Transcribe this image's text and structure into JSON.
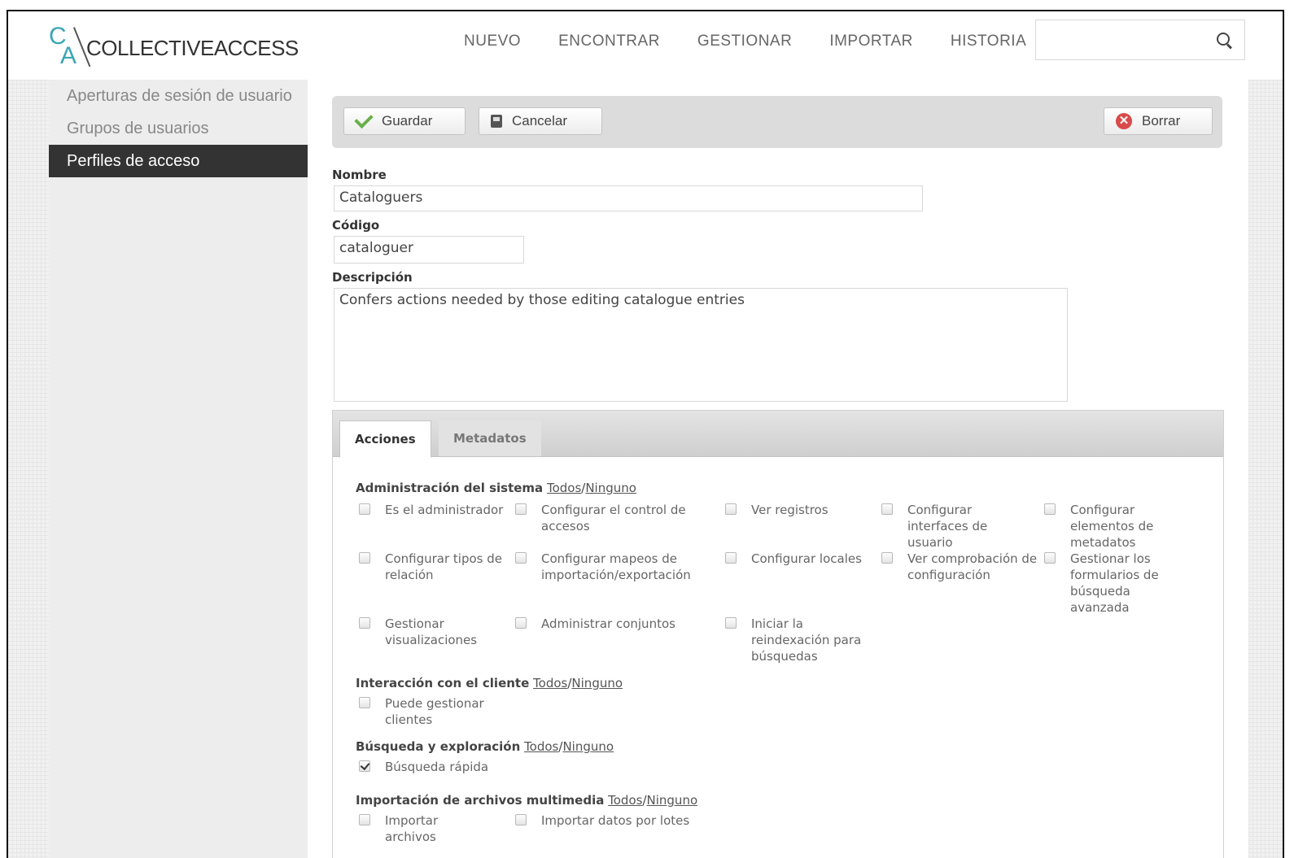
{
  "header": {
    "logo_c": "C",
    "logo_a": "A",
    "logo_word": "COLLECTIVEACCESS",
    "nav": [
      "NUEVO",
      "ENCONTRAR",
      "GESTIONAR",
      "IMPORTAR",
      "HISTORIA"
    ],
    "search_value": ""
  },
  "sidebar": {
    "items": [
      {
        "label": "Aperturas de sesión de usuario"
      },
      {
        "label": "Grupos de usuarios"
      },
      {
        "label": "Perfiles de acceso"
      }
    ]
  },
  "toolbar": {
    "save_label": "Guardar",
    "cancel_label": "Cancelar",
    "delete_label": "Borrar"
  },
  "form": {
    "name_label": "Nombre",
    "name_value": "Cataloguers",
    "code_label": "Código",
    "code_value": "cataloguer",
    "desc_label": "Descripción",
    "desc_value": "Confers actions needed by those editing catalogue entries"
  },
  "tabs": [
    "Acciones",
    "Metadatos"
  ],
  "links": {
    "all": "Todos",
    "none": "Ninguno"
  },
  "sections": [
    {
      "title": "Administración del sistema",
      "perms": [
        {
          "label": "Es el administrador",
          "checked": false
        },
        {
          "label": "Configurar el control de accesos",
          "checked": false
        },
        {
          "label": "Ver registros",
          "checked": false
        },
        {
          "label": "Configurar interfaces de usuario",
          "checked": false
        },
        {
          "label": "Configurar elementos de metadatos",
          "checked": false
        },
        {
          "label": "Configurar tipos de relación",
          "checked": false
        },
        {
          "label": "Configurar mapeos de importación/exportación",
          "checked": false
        },
        {
          "label": "Configurar locales",
          "checked": false
        },
        {
          "label": "Ver comprobación de configuración",
          "checked": false
        },
        {
          "label": "Gestionar los formularios de búsqueda avanzada",
          "checked": false
        },
        {
          "label": "Gestionar visualizaciones",
          "checked": false
        },
        {
          "label": "Administrar conjuntos",
          "checked": false
        },
        {
          "label": "Iniciar la reindexación para búsquedas",
          "checked": false
        }
      ]
    },
    {
      "title": "Interacción con el cliente",
      "perms": [
        {
          "label": "Puede gestionar clientes",
          "checked": false
        }
      ]
    },
    {
      "title": "Búsqueda y exploración",
      "perms": [
        {
          "label": "Búsqueda rápida",
          "checked": true
        }
      ]
    },
    {
      "title": "Importación de archivos multimedia",
      "perms": [
        {
          "label": "Importar archivos",
          "checked": false
        },
        {
          "label": "Importar datos por lotes",
          "checked": false
        }
      ]
    }
  ]
}
